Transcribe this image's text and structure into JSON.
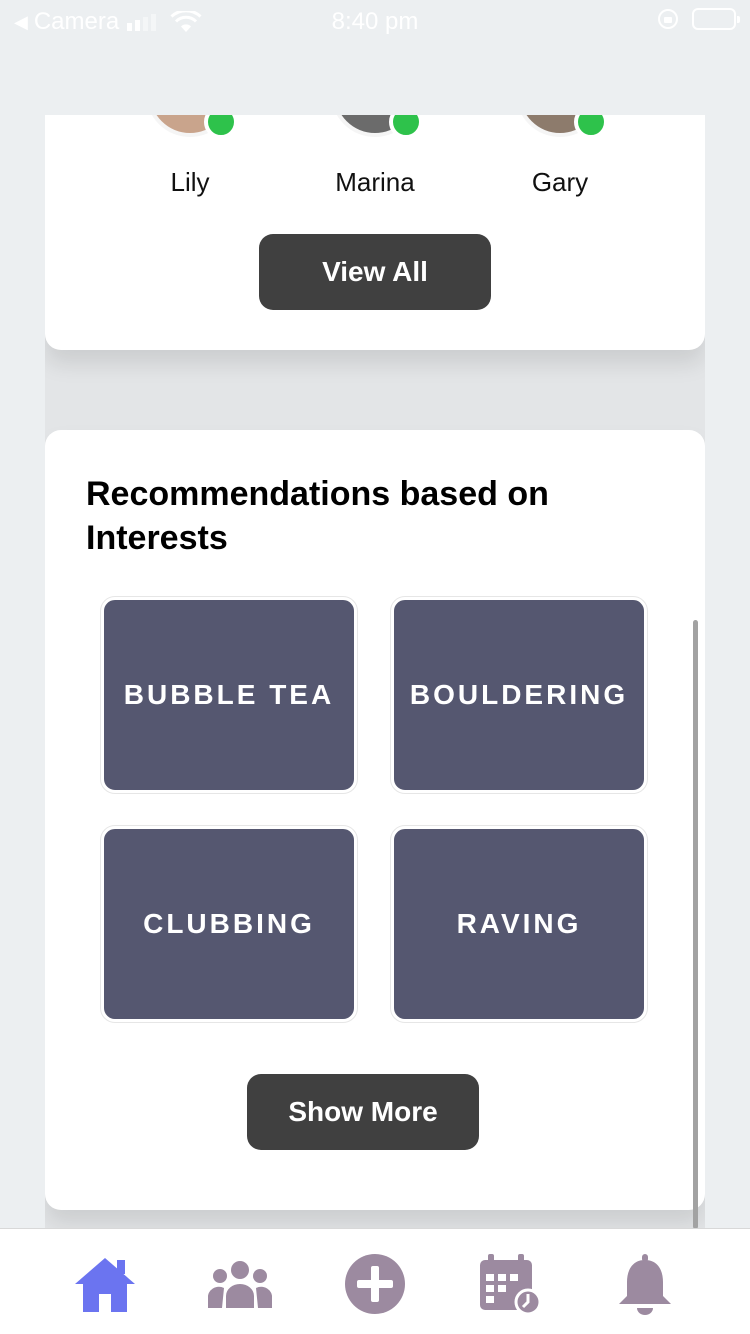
{
  "status_bar": {
    "back_label": "Camera",
    "time": "8:40 pm"
  },
  "friends": {
    "items": [
      {
        "name": "Lily",
        "online": true
      },
      {
        "name": "Marina",
        "online": true
      },
      {
        "name": "Gary",
        "online": true
      }
    ],
    "view_all_label": "View All"
  },
  "interests": {
    "title": "Recommendations based on Interests",
    "items": [
      {
        "label": "BUBBLE TEA"
      },
      {
        "label": "BOULDERING"
      },
      {
        "label": "CLUBBING"
      },
      {
        "label": "RAVING"
      }
    ],
    "show_more_label": "Show More"
  },
  "tab_bar": {
    "items": [
      {
        "icon": "home-icon",
        "active": true
      },
      {
        "icon": "people-icon",
        "active": false
      },
      {
        "icon": "add-circle-icon",
        "active": false
      },
      {
        "icon": "calendar-icon",
        "active": false
      },
      {
        "icon": "bell-icon",
        "active": false
      }
    ]
  },
  "colors": {
    "accent": "#6b74f0",
    "tab_inactive": "#9c8aa0",
    "tile_bg": "#555770",
    "button_bg": "#404040",
    "online": "#2ec24b"
  }
}
